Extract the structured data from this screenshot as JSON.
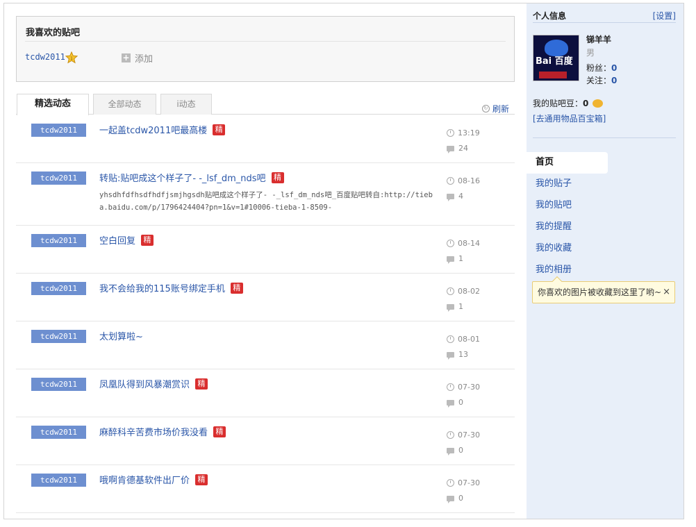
{
  "favorites": {
    "title": "我喜欢的贴吧",
    "forum": "tcdw2011",
    "add_label": "添加"
  },
  "tabs": [
    {
      "label": "精选动态"
    },
    {
      "label": "全部动态"
    },
    {
      "label": "i动态"
    }
  ],
  "refresh_label": "刷新",
  "feed": [
    {
      "user": "tcdw2011",
      "title": "一起盖tcdw2011吧最高楼",
      "jing": "精",
      "excerpt": "",
      "date": "13:19",
      "count": "24"
    },
    {
      "user": "tcdw2011",
      "title": "转贴:贴吧成这个样子了- -_lsf_dm_nds吧",
      "jing": "精",
      "excerpt": "yhsdhfdfhsdfhdfjsmjhgsdh贴吧成这个样子了- -_lsf_dm_nds吧_百度贴吧转自:http://tieba.baidu.com/p/1796424404?pn=1&v=1#10006-tieba-1-8509-",
      "date": "08-16",
      "count": "4"
    },
    {
      "user": "tcdw2011",
      "title": "空白回复",
      "jing": "精",
      "excerpt": "",
      "date": "08-14",
      "count": "1"
    },
    {
      "user": "tcdw2011",
      "title": "我不会给我的115账号绑定手机",
      "jing": "精",
      "excerpt": "",
      "date": "08-02",
      "count": "1"
    },
    {
      "user": "tcdw2011",
      "title": "太划算啦~",
      "jing": "",
      "excerpt": "",
      "date": "08-01",
      "count": "13"
    },
    {
      "user": "tcdw2011",
      "title": "凤凰队得到风暴潮赏识",
      "jing": "精",
      "excerpt": "",
      "date": "07-30",
      "count": "0"
    },
    {
      "user": "tcdw2011",
      "title": "麻醉科辛苦费市场价我没看",
      "jing": "精",
      "excerpt": "",
      "date": "07-30",
      "count": "0"
    },
    {
      "user": "tcdw2011",
      "title": "哦啊肯德基软件出厂价",
      "jing": "精",
      "excerpt": "",
      "date": "07-30",
      "count": "0"
    }
  ],
  "sidebar": {
    "title": "个人信息",
    "settings": "[设置]",
    "avatar_text": "Bai 百度",
    "name": "锑羊羊",
    "gender": "男",
    "fans_label": "粉丝：",
    "fans": "0",
    "follow_label": "关注：",
    "follow": "0",
    "beans_label": "我的贴吧豆：",
    "beans": "0",
    "treasure_link": "[去通用物品百宝箱]",
    "nav": [
      {
        "label": "首页"
      },
      {
        "label": "我的贴子"
      },
      {
        "label": "我的贴吧"
      },
      {
        "label": "我的提醒"
      },
      {
        "label": "我的收藏"
      },
      {
        "label": "我的相册"
      }
    ],
    "tip": "你喜欢的图片被收藏到这里了哟~",
    "tip_close": "×"
  }
}
